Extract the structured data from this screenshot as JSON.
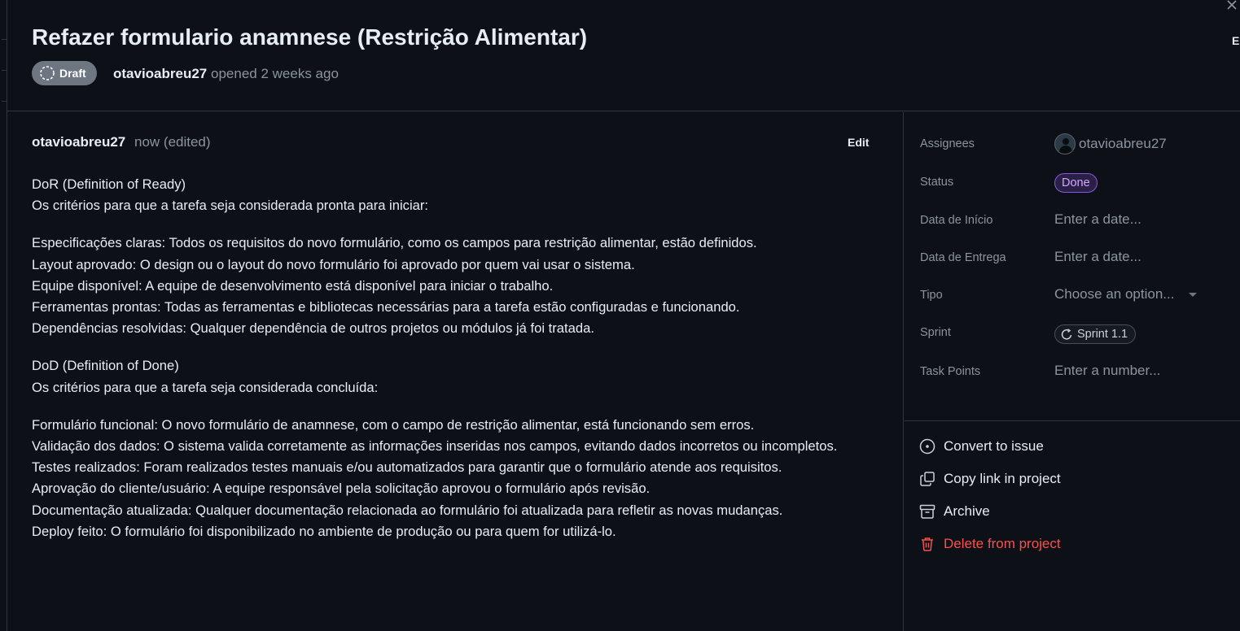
{
  "header": {
    "title": "Refazer formulario anamnese (Restrição Alimentar)",
    "edit_label": "Edit",
    "draft_label": "Draft",
    "author": "otavioabreu27",
    "opened_text": "opened 2 weeks ago"
  },
  "comment": {
    "author": "otavioabreu27",
    "meta": "now (edited)",
    "edit_label": "Edit",
    "paragraphs": [
      [
        "DoR (Definition of Ready)",
        "Os critérios para que a tarefa seja considerada pronta para iniciar:"
      ],
      [
        "Especificações claras: Todos os requisitos do novo formulário, como os campos para restrição alimentar, estão definidos.",
        "Layout aprovado: O design ou o layout do novo formulário foi aprovado por quem vai usar o sistema.",
        "Equipe disponível: A equipe de desenvolvimento está disponível para iniciar o trabalho.",
        "Ferramentas prontas: Todas as ferramentas e bibliotecas necessárias para a tarefa estão configuradas e funcionando.",
        "Dependências resolvidas: Qualquer dependência de outros projetos ou módulos já foi tratada."
      ],
      [
        "DoD (Definition of Done)",
        "Os critérios para que a tarefa seja considerada concluída:"
      ],
      [
        "Formulário funcional: O novo formulário de anamnese, com o campo de restrição alimentar, está funcionando sem erros.",
        "Validação dos dados: O sistema valida corretamente as informações inseridas nos campos, evitando dados incorretos ou incompletos.",
        "Testes realizados: Foram realizados testes manuais e/ou automatizados para garantir que o formulário atende aos requisitos.",
        "Aprovação do cliente/usuário: A equipe responsável pela solicitação aprovou o formulário após revisão.",
        "Documentação atualizada: Qualquer documentação relacionada ao formulário foi atualizada para refletir as novas mudanças.",
        "Deploy feito: O formulário foi disponibilizado no ambiente de produção ou para quem for utilizá-lo."
      ]
    ]
  },
  "sidebar": {
    "assignees": {
      "label": "Assignees",
      "value": "otavioabreu27"
    },
    "status": {
      "label": "Status",
      "value": "Done",
      "color": "#8957e5"
    },
    "start_date": {
      "label": "Data de Início",
      "placeholder": "Enter a date..."
    },
    "due_date": {
      "label": "Data de Entrega",
      "placeholder": "Enter a date..."
    },
    "type": {
      "label": "Tipo",
      "placeholder": "Choose an option..."
    },
    "sprint": {
      "label": "Sprint",
      "value": "Sprint 1.1"
    },
    "task_points": {
      "label": "Task Points",
      "placeholder": "Enter a number..."
    },
    "actions": {
      "convert": "Convert to issue",
      "copy_link": "Copy link in project",
      "archive": "Archive",
      "delete": "Delete from project",
      "delete_color": "#f85149"
    }
  }
}
